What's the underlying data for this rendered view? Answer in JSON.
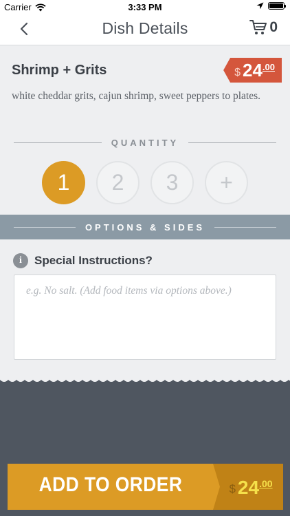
{
  "status_bar": {
    "carrier": "Carrier",
    "time": "3:33 PM",
    "battery_level": 1.0
  },
  "nav": {
    "title": "Dish Details",
    "cart_count": "0",
    "back_icon": "chevron-left-icon",
    "cart_icon": "cart-icon"
  },
  "dish": {
    "name": "Shrimp + Grits",
    "price_currency": "$",
    "price_whole": "24",
    "price_cents": ".00",
    "description": "white cheddar grits, cajun shrimp, sweet peppers to plates."
  },
  "quantity": {
    "label": "QUANTITY",
    "options": [
      "1",
      "2",
      "3",
      "+"
    ],
    "selected": "1"
  },
  "options_sides": {
    "label": "OPTIONS & SIDES"
  },
  "instructions": {
    "title": "Special Instructions?",
    "info_icon": "i",
    "placeholder": "e.g. No salt. (Add food items via options above.)",
    "value": ""
  },
  "add_to_order": {
    "label": "ADD TO ORDER",
    "price_currency": "$",
    "price_whole": "24",
    "price_cents": ".00"
  },
  "colors": {
    "accent": "#dc9b25",
    "price_tag": "#d4563c",
    "options_bar": "#8b9aa5",
    "footer_bg": "#4f5660"
  }
}
